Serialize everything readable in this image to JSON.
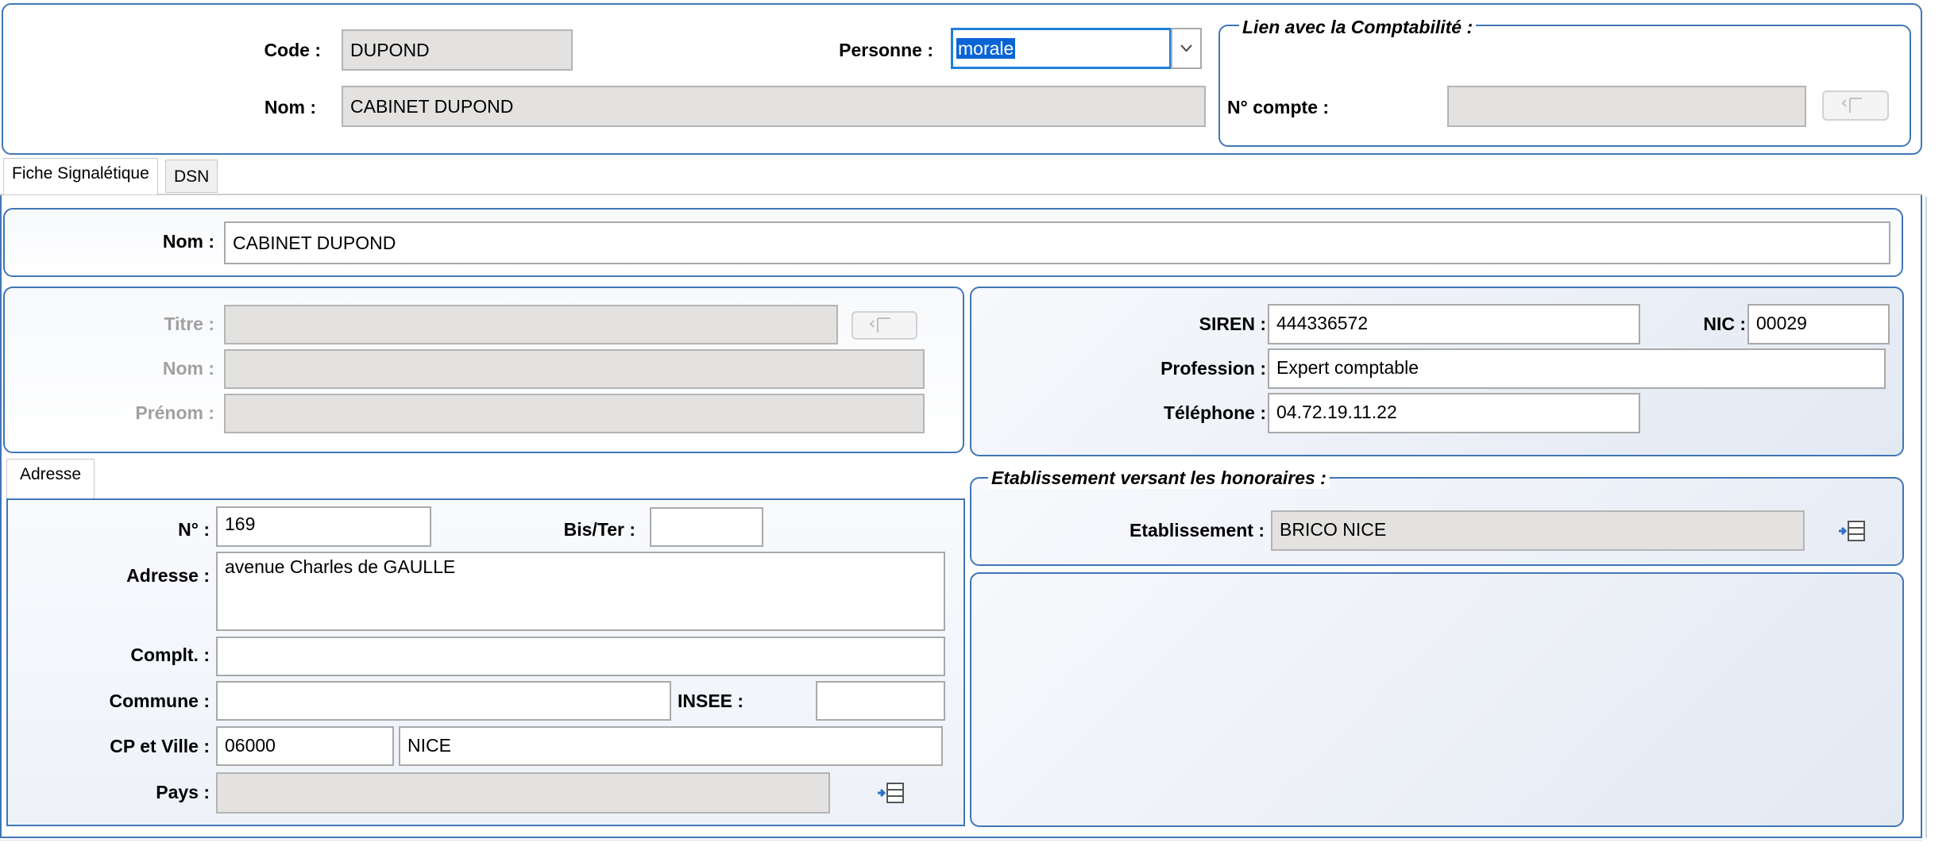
{
  "header": {
    "code_label": "Code :",
    "code_value": "DUPOND",
    "personne_label": "Personne :",
    "personne_value": "morale",
    "nom_label": "Nom :",
    "nom_value": "CABINET DUPOND"
  },
  "comptabilite": {
    "legend": "Lien avec la Comptabilité :",
    "compte_label": "N° compte :",
    "compte_value": ""
  },
  "tabs": [
    {
      "label": "Fiche Signalétique",
      "active": true
    },
    {
      "label": "DSN",
      "active": false
    }
  ],
  "fiche": {
    "nom_label": "Nom :",
    "nom_value": "CABINET DUPOND"
  },
  "personne_physique": {
    "titre_label": "Titre :",
    "titre_value": "",
    "nom_label": "Nom :",
    "nom_value": "",
    "prenom_label": "Prénom :",
    "prenom_value": ""
  },
  "entreprise": {
    "siren_label": "SIREN :",
    "siren_value": "444336572",
    "nic_label": "NIC :",
    "nic_value": "00029",
    "profession_label": "Profession :",
    "profession_value": "Expert comptable",
    "telephone_label": "Téléphone :",
    "telephone_value": "04.72.19.11.22"
  },
  "adresse_tab": {
    "label": "Adresse"
  },
  "adresse": {
    "numero_label": "N° :",
    "numero_value": "169",
    "bister_label": "Bis/Ter :",
    "bister_value": "",
    "adresse_label": "Adresse :",
    "adresse_value": "avenue Charles de GAULLE",
    "complement_label": "Complt. :",
    "complement_value": "",
    "commune_label": "Commune :",
    "commune_value": "",
    "insee_label": "INSEE :",
    "insee_value": "",
    "cpville_label": "CP et Ville :",
    "cp_value": "06000",
    "ville_value": "NICE",
    "pays_label": "Pays :",
    "pays_value": ""
  },
  "etablissement": {
    "legend": "Etablissement versant les honoraires :",
    "label": "Etablissement :",
    "value": "BRICO NICE"
  },
  "colors": {
    "panel_border": "#3f76b6",
    "readonly_bg": "#e4e2e0",
    "focus_border": "#1e7fd8",
    "selection_bg": "#0a64d6"
  }
}
